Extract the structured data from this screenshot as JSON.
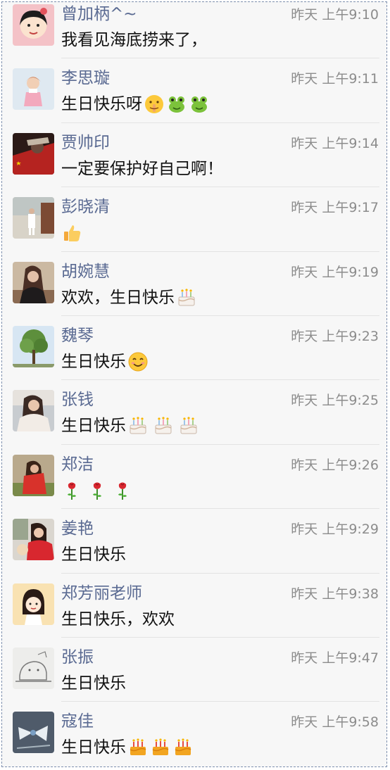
{
  "messages": [
    {
      "name": "曾加柄^~",
      "time": "昨天 上午9:10",
      "text": "我看见海底捞来了，",
      "emojis": []
    },
    {
      "name": "李思璇",
      "time": "昨天 上午9:11",
      "text": "生日快乐呀",
      "emojis": [
        "shush-face",
        "frog",
        "frog"
      ]
    },
    {
      "name": "贾帅印",
      "time": "昨天 上午9:14",
      "text": "一定要保护好自己啊！",
      "emojis": []
    },
    {
      "name": "彭晓清",
      "time": "昨天 上午9:17",
      "text": "",
      "emojis": [
        "thumbs-up"
      ]
    },
    {
      "name": "胡婉慧",
      "time": "昨天 上午9:19",
      "text": "欢欢，生日快乐",
      "emojis": [
        "cake"
      ]
    },
    {
      "name": "魏琴",
      "time": "昨天 上午9:23",
      "text": "生日快乐",
      "emojis": [
        "smile"
      ]
    },
    {
      "name": "张钱",
      "time": "昨天 上午9:25",
      "text": "生日快乐",
      "emojis": [
        "cake",
        "cake",
        "cake"
      ]
    },
    {
      "name": "郑洁",
      "time": "昨天 上午9:26",
      "text": "",
      "emojis": [
        "rose",
        "rose",
        "rose"
      ]
    },
    {
      "name": "姜艳",
      "time": "昨天 上午9:29",
      "text": "生日快乐",
      "emojis": []
    },
    {
      "name": "郑芳丽老师",
      "time": "昨天 上午9:38",
      "text": "生日快乐，欢欢",
      "emojis": []
    },
    {
      "name": "张振",
      "time": "昨天 上午9:47",
      "text": "生日快乐",
      "emojis": []
    },
    {
      "name": "寇佳",
      "time": "昨天 上午9:58",
      "text": "生日快乐",
      "emojis": [
        "gold-cake",
        "gold-cake",
        "gold-cake"
      ]
    }
  ],
  "colors": {
    "name": "#5a6a92",
    "time": "#8c8c8c",
    "text": "#111111",
    "background": "#f7f7f7",
    "divider": "#e3e3e3"
  }
}
